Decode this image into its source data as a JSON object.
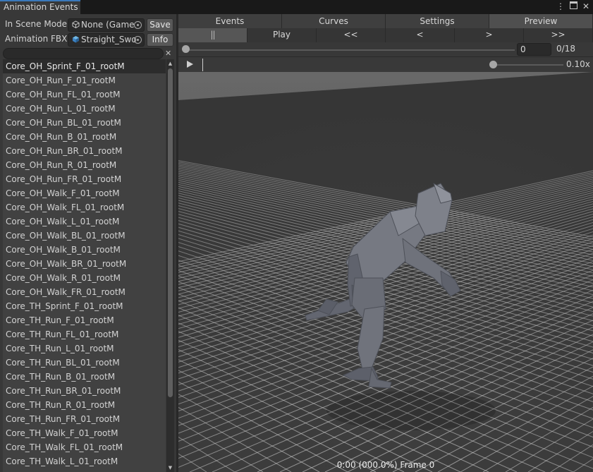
{
  "window": {
    "tab_title": "Animation Events",
    "menu_icon": "kebab-menu-icon",
    "maximize_icon": "maximize-icon",
    "close_icon": "close-icon"
  },
  "left": {
    "in_scene_model_label": "In Scene Model",
    "in_scene_model_value": "None (Game",
    "save_label": "Save",
    "animation_fbx_label": "Animation FBX",
    "animation_fbx_value": "Straight_Swo",
    "info_label": "Info",
    "search_value": "",
    "clips": [
      "Core_OH_Sprint_F_01_rootM",
      "Core_OH_Run_F_01_rootM",
      "Core_OH_Run_FL_01_rootM",
      "Core_OH_Run_L_01_rootM",
      "Core_OH_Run_BL_01_rootM",
      "Core_OH_Run_B_01_rootM",
      "Core_OH_Run_BR_01_rootM",
      "Core_OH_Run_R_01_rootM",
      "Core_OH_Run_FR_01_rootM",
      "Core_OH_Walk_F_01_rootM",
      "Core_OH_Walk_FL_01_rootM",
      "Core_OH_Walk_L_01_rootM",
      "Core_OH_Walk_BL_01_rootM",
      "Core_OH_Walk_B_01_rootM",
      "Core_OH_Walk_BR_01_rootM",
      "Core_OH_Walk_R_01_rootM",
      "Core_OH_Walk_FR_01_rootM",
      "Core_TH_Sprint_F_01_rootM",
      "Core_TH_Run_F_01_rootM",
      "Core_TH_Run_FL_01_rootM",
      "Core_TH_Run_L_01_rootM",
      "Core_TH_Run_BL_01_rootM",
      "Core_TH_Run_B_01_rootM",
      "Core_TH_Run_BR_01_rootM",
      "Core_TH_Run_R_01_rootM",
      "Core_TH_Run_FR_01_rootM",
      "Core_TH_Walk_F_01_rootM",
      "Core_TH_Walk_FL_01_rootM",
      "Core_TH_Walk_L_01_rootM"
    ],
    "selected_index": 0
  },
  "right": {
    "tabs": [
      "Events",
      "Curves",
      "Settings",
      "Preview"
    ],
    "active_tab": 3,
    "controls": [
      "||",
      "Play",
      "<<",
      "<",
      ">",
      ">>"
    ],
    "frame_value": "0",
    "frame_total": "0/18",
    "frame_progress": 0,
    "speed_label": "0.10x",
    "speed_fraction": 0,
    "frame_readout": "0:00 (000.0%) Frame 0"
  },
  "colors": {
    "accent": "#3a79bb",
    "panel": "#383838",
    "list_bg": "#414141",
    "selected_row": "#2c2c2c"
  }
}
